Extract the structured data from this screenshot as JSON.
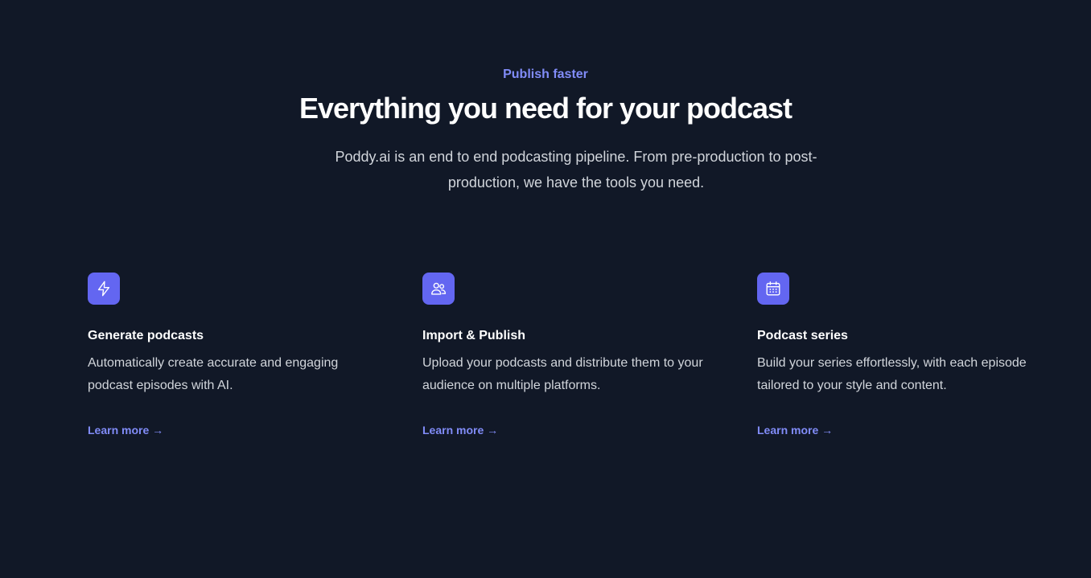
{
  "header": {
    "eyebrow": "Publish faster",
    "title": "Everything you need for your podcast",
    "subtitle": "Poddy.ai is an end to end podcasting pipeline. From pre-production to post-production, we have the tools you need."
  },
  "features": [
    {
      "icon": "lightning-bolt-icon",
      "title": "Generate podcasts",
      "description": "Automatically create accurate and engaging podcast episodes with AI.",
      "link": "Learn more →"
    },
    {
      "icon": "users-icon",
      "title": "Import & Publish",
      "description": "Upload your podcasts and distribute them to your audience on multiple platforms.",
      "link": "Learn more →"
    },
    {
      "icon": "calendar-icon",
      "title": "Podcast series",
      "description": "Build your series effortlessly, with each episode tailored to your style and content.",
      "link": "Learn more →"
    }
  ],
  "colors": {
    "background": "#111827",
    "accent": "#6366f1",
    "accent_text": "#818cf8",
    "body_text": "#d1d5db",
    "heading_text": "#ffffff"
  }
}
